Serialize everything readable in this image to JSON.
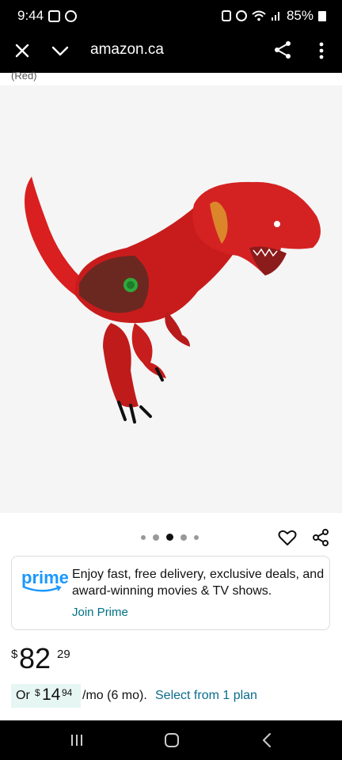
{
  "status_bar": {
    "time": "9:44",
    "battery": "85%"
  },
  "browser": {
    "close_icon": "close-icon",
    "chevron_icon": "chevron-down-icon",
    "url": "amazon.ca",
    "share_icon": "share-icon",
    "more_icon": "more-vertical-icon"
  },
  "product": {
    "caption_top": "(Red)",
    "image_desc_icon": "product-image",
    "carousel": {
      "count": 5,
      "active_index": 2
    }
  },
  "prime": {
    "logo": "prime",
    "text": "Enjoy fast, free delivery, exclusive deals, and award-winning movies & TV shows.",
    "join": "Join Prime"
  },
  "price": {
    "symbol": "$",
    "whole": "82",
    "fraction": "29"
  },
  "installment": {
    "or": "Or",
    "symbol": "$",
    "whole": "14",
    "fraction": "94",
    "suffix": "/mo (6 mo).",
    "link": "Select from 1 plan"
  },
  "colors": {
    "prime_blue": "#1a98ff",
    "link_teal": "#007185",
    "installment_bg": "#e6f6f2"
  }
}
